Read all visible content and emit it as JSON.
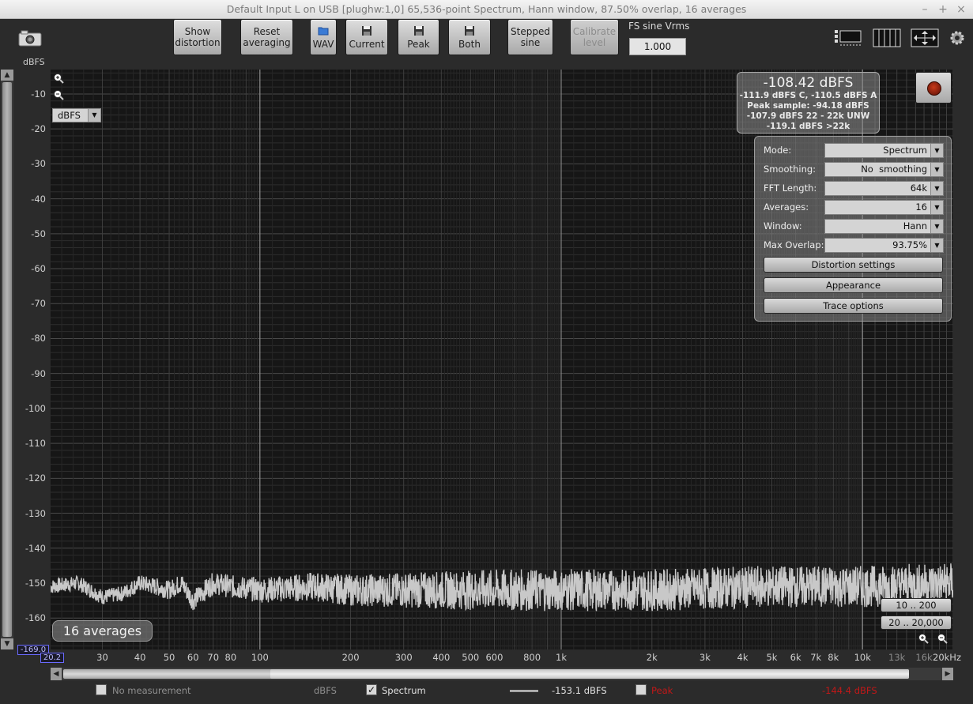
{
  "window": {
    "title": "Default Input L on USB [plughw:1,0] 65,536-point Spectrum, Hann window, 87.50% overlap, 16 averages",
    "min": "–",
    "max": "+",
    "close": "×"
  },
  "toolbar": {
    "show_distortion": "Show\ndistortion",
    "reset_averaging": "Reset\naveraging",
    "wav": "WAV",
    "current": "Current",
    "peak": "Peak",
    "both": "Both",
    "stepped_sine": "Stepped\nsine",
    "calibrate_level": "Calibrate\nlevel",
    "fs_label": "FS sine Vrms",
    "fs_value": "1.000"
  },
  "axis": {
    "y_title": "dBFS",
    "unit_select": "dBFS",
    "y_min_box": "-169.0",
    "x_min_box": "20.2",
    "y_ticks": [
      "-10",
      "-20",
      "-30",
      "-40",
      "-50",
      "-60",
      "-70",
      "-80",
      "-90",
      "-100",
      "-110",
      "-120",
      "-130",
      "-140",
      "-150",
      "-160"
    ],
    "x_ticks": [
      "30",
      "40",
      "50",
      "60",
      "70",
      "80",
      "100",
      "200",
      "300",
      "400",
      "500",
      "600",
      "800",
      "1k",
      "2k",
      "3k",
      "4k",
      "5k",
      "6k",
      "7k",
      "8k",
      "10k",
      "13k",
      "16k",
      "20kHz"
    ]
  },
  "readout": {
    "main": "-108.42 dBFS",
    "line1": "-111.9 dBFS C, -110.5 dBFS A",
    "line2": "Peak sample: -94.18 dBFS",
    "line3": "-107.9 dBFS 22 - 22k UNW",
    "line4": "-119.1 dBFS >22k"
  },
  "panel": {
    "mode_label": "Mode:",
    "mode_value": "Spectrum",
    "smoothing_label": "Smoothing:",
    "smoothing_value": "No  smoothing",
    "fft_label": "FFT Length:",
    "fft_value": "64k",
    "averages_label": "Averages:",
    "averages_value": "16",
    "window_label": "Window:",
    "window_value": "Hann",
    "overlap_label": "Max Overlap:",
    "overlap_value": "93.75%",
    "distortion_settings": "Distortion settings",
    "appearance": "Appearance",
    "trace_options": "Trace options"
  },
  "overlay": {
    "averages_badge": "16 averages",
    "range1": "10 .. 200",
    "range2": "20 .. 20,000"
  },
  "status": {
    "no_measurement": "No measurement",
    "unit": "dBFS",
    "spectrum_label": "Spectrum",
    "spectrum_check": "✓",
    "spectrum_value": "-153.1 dBFS",
    "peak_label": "Peak",
    "peak_value": "-144.4 dBFS"
  },
  "colors": {
    "trace": "#c8c8c8",
    "peak": "#d01818",
    "grid_minor": "#2e2e2e",
    "grid_major": "#4a4a4a"
  },
  "chart_data": {
    "type": "line",
    "xlabel": "",
    "ylabel": "dBFS",
    "x_scale": "log",
    "xlim": [
      20.2,
      20000
    ],
    "ylim": [
      -169,
      -3
    ],
    "grid": true,
    "series": [
      {
        "name": "Spectrum",
        "noise_floor_db": -152,
        "x": [
          20.2,
          25,
          30,
          35,
          40,
          45,
          50,
          55,
          60,
          70,
          80,
          100,
          150,
          200,
          300,
          500,
          1000,
          2000,
          5000,
          10000,
          20000
        ],
        "y": [
          -151,
          -150,
          -154,
          -153,
          -150,
          -151,
          -152,
          -150,
          -155,
          -150,
          -151,
          -152,
          -151,
          -152,
          -152,
          -152,
          -152,
          -152,
          -151,
          -151,
          -150
        ]
      }
    ]
  }
}
